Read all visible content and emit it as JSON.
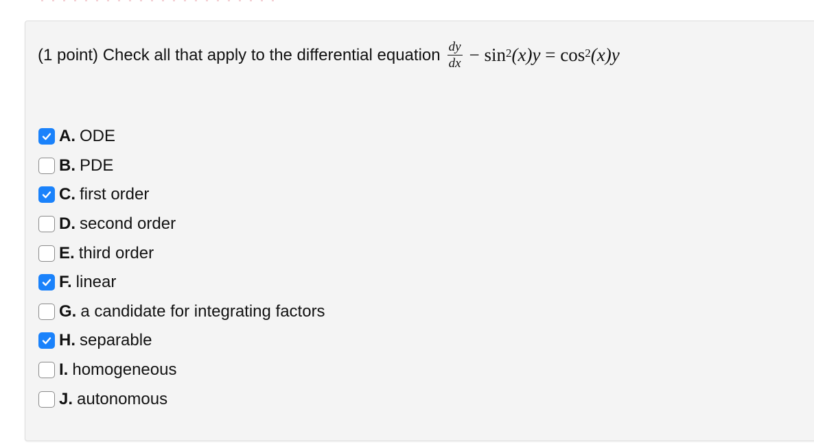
{
  "question": {
    "points_label": "(1 point)",
    "prompt": "Check all that apply to the differential equation",
    "equation": {
      "fraction_numerator": "dy",
      "fraction_denominator": "dx",
      "minus": "−",
      "term1_func": "sin",
      "term1_exponent": "2",
      "term1_arg": "(x)y",
      "equals": "=",
      "term2_func": "cos",
      "term2_exponent": "2",
      "term2_arg": "(x)y"
    }
  },
  "options": [
    {
      "letter": "A.",
      "label": "ODE",
      "checked": true
    },
    {
      "letter": "B.",
      "label": "PDE",
      "checked": false
    },
    {
      "letter": "C.",
      "label": "first order",
      "checked": true
    },
    {
      "letter": "D.",
      "label": "second order",
      "checked": false
    },
    {
      "letter": "E.",
      "label": "third order",
      "checked": false
    },
    {
      "letter": "F.",
      "label": "linear",
      "checked": true
    },
    {
      "letter": "G.",
      "label": "a candidate for integrating factors",
      "checked": false
    },
    {
      "letter": "H.",
      "label": "separable",
      "checked": true
    },
    {
      "letter": "I.",
      "label": "homogeneous",
      "checked": false
    },
    {
      "letter": "J.",
      "label": "autonomous",
      "checked": false
    }
  ],
  "colors": {
    "checkbox_checked": "#1a82fb",
    "panel_background": "#f4f4f4"
  }
}
